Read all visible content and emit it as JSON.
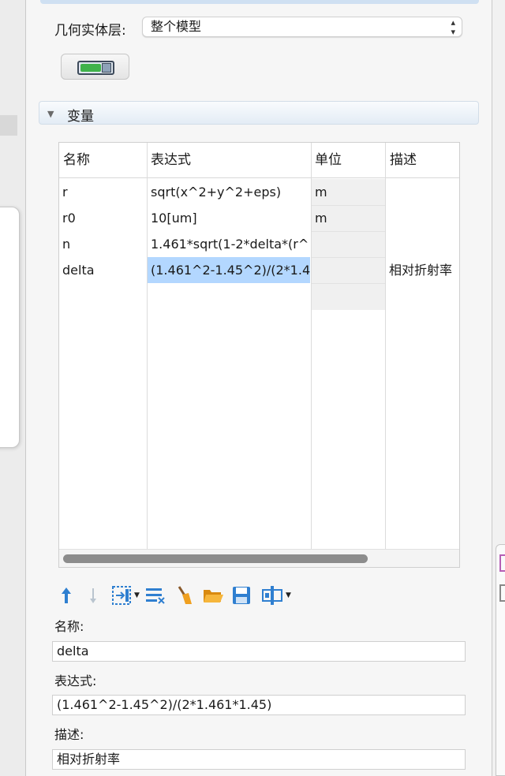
{
  "geometry": {
    "label": "几何实体层:",
    "selected": "整个模型"
  },
  "section": {
    "title": "变量"
  },
  "table": {
    "headers": [
      "名称",
      "表达式",
      "单位",
      "描述"
    ],
    "rows": [
      {
        "name": "r",
        "expression": "sqrt(x^2+y^2+eps)",
        "unit": "m",
        "description": ""
      },
      {
        "name": "r0",
        "expression": "10[um]",
        "unit": "m",
        "description": ""
      },
      {
        "name": "n",
        "expression": "1.461*sqrt(1-2*delta*(r^",
        "unit": "",
        "description": ""
      },
      {
        "name": "delta",
        "expression": "(1.461^2-1.45^2)/(2*1.46",
        "unit": "",
        "description": "相对折射率"
      }
    ],
    "selected_row": 3
  },
  "toolbar": {
    "icons": [
      "move-up-icon",
      "move-down-icon",
      "insert-icon",
      "clear-table-icon",
      "broom-icon",
      "open-folder-icon",
      "save-icon",
      "column-options-icon"
    ]
  },
  "form": {
    "name_label": "名称:",
    "name_value": "delta",
    "expression_label": "表达式:",
    "expression_value": "(1.461^2-1.45^2)/(2*1.461*1.45)",
    "description_label": "描述:",
    "description_value": "相对折射率"
  },
  "colors": {
    "selection": "#b3d7ff",
    "toolbar_blue": "#2f7fd0",
    "folder_orange": "#f0a020",
    "toggle_green": "#3fb24a"
  }
}
